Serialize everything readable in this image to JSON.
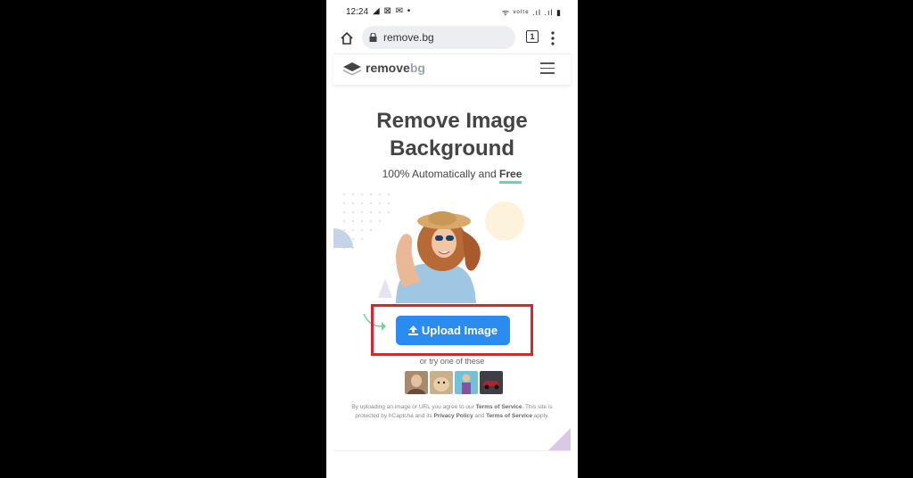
{
  "status_bar": {
    "time": "12:24",
    "left_icons": "◢ ⊠ ✉ •",
    "right_icons": "ᯤ ᵛᵒˡᵗᵉ .ıl .ıl ▮"
  },
  "browser": {
    "url": "remove.bg",
    "tab_count": "1"
  },
  "site": {
    "logo_primary": "remove",
    "logo_secondary": "bg"
  },
  "hero": {
    "title_line1": "Remove Image",
    "title_line2": "Background",
    "subtitle_prefix": "100% Automatically and ",
    "subtitle_free": "Free"
  },
  "upload": {
    "label": "Upload Image"
  },
  "samples": {
    "label": "or try one of these"
  },
  "legal": {
    "part1": "By uploading an image or URL you agree to our ",
    "tos1": "Terms of Service",
    "part2": ". This site is protected by hCaptcha and its ",
    "privacy": "Privacy Policy",
    "part3": " and ",
    "tos2": "Terms of Service",
    "part4": " apply."
  },
  "colors": {
    "accent_blue": "#2b8cf0",
    "highlight_red": "#d8242b",
    "free_underline": "#6fd3a6"
  }
}
